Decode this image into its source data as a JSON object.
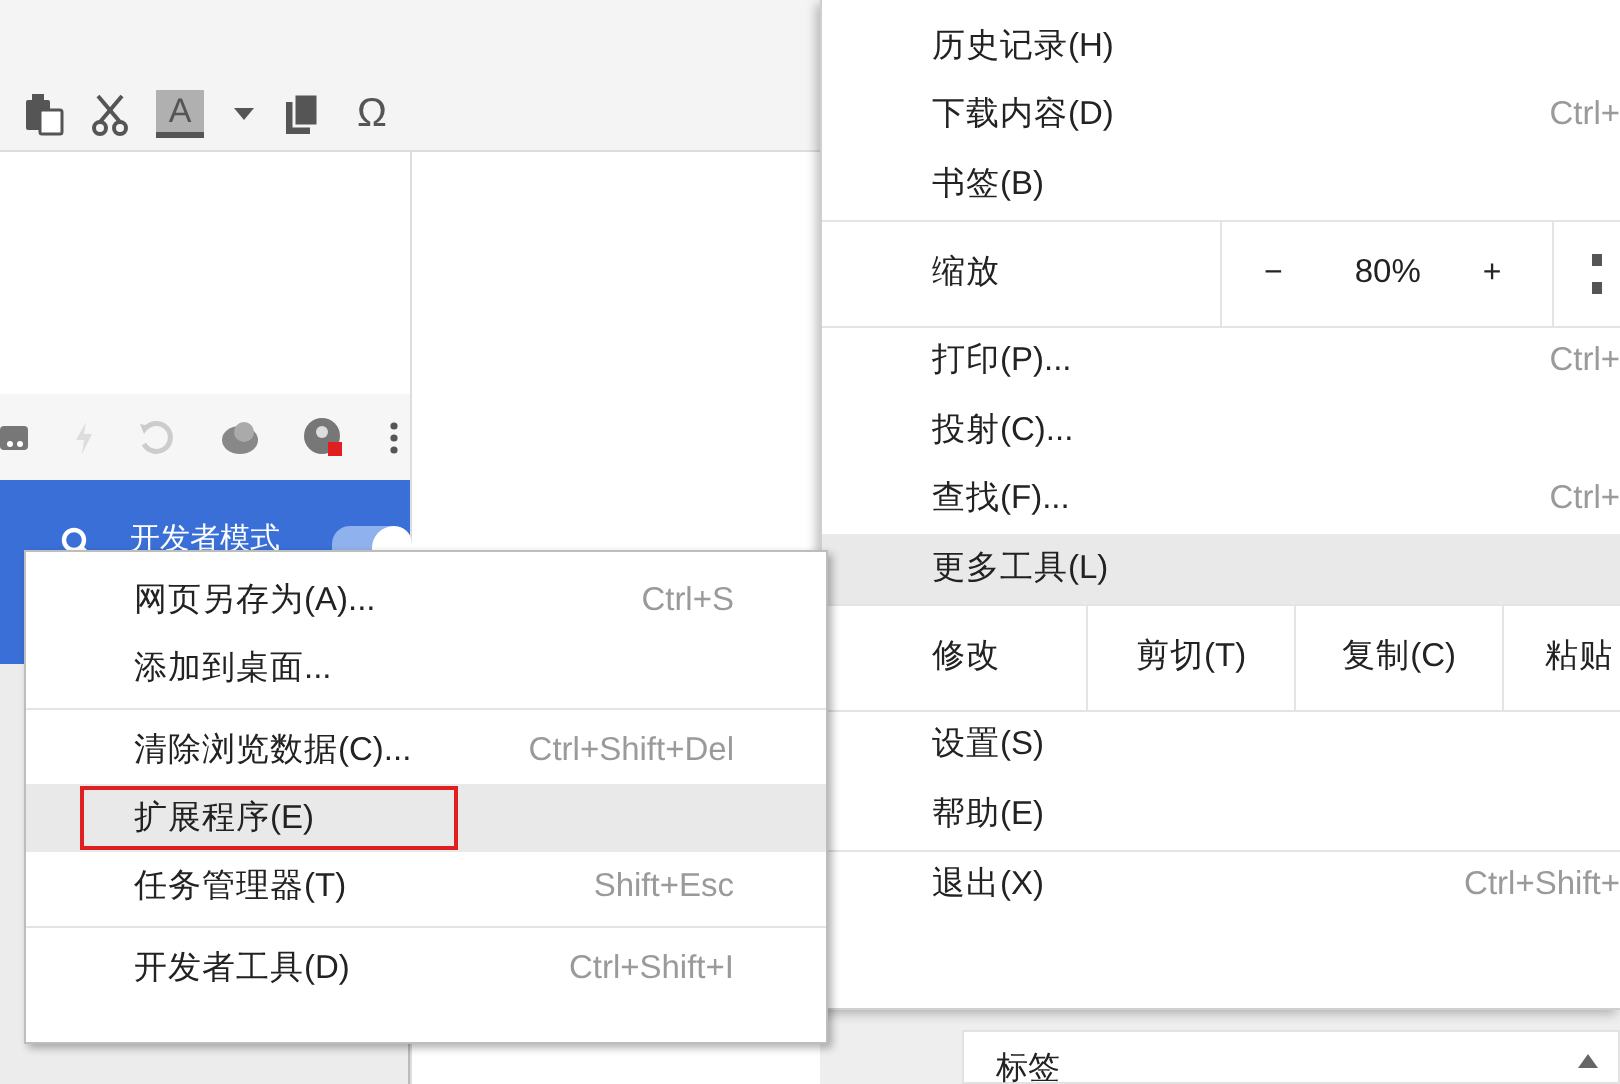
{
  "editor_toolbar": [
    {
      "kind": "paste"
    },
    {
      "kind": "cut"
    },
    {
      "kind": "font_color",
      "label": "A"
    },
    {
      "kind": "copy"
    },
    {
      "kind": "symbol",
      "label": "Ω"
    }
  ],
  "extensions_header": {
    "label": "开发者模式",
    "on": true
  },
  "main_menu": [
    {
      "items": [
        {
          "kind": "item",
          "label": "历史记录(H)",
          "selected": false
        },
        {
          "kind": "item",
          "label": "下载内容(D)",
          "shortcut": "Ctrl+",
          "selected": false
        },
        {
          "kind": "item",
          "label": "书签(B)",
          "selected": false
        }
      ]
    },
    {
      "items": [
        {
          "kind": "zoom",
          "label": "缩放",
          "minus": "−",
          "value": "80%",
          "plus": "+"
        }
      ]
    },
    {
      "items": [
        {
          "kind": "item",
          "label": "打印(P)...",
          "shortcut": "Ctrl+",
          "selected": false
        },
        {
          "kind": "item",
          "label": "投射(C)...",
          "selected": false
        },
        {
          "kind": "item",
          "label": "查找(F)...",
          "shortcut": "Ctrl+",
          "selected": false
        },
        {
          "kind": "item",
          "label": "更多工具(L)",
          "selected": true
        }
      ]
    },
    {
      "items": [
        {
          "kind": "edit",
          "label": "修改",
          "buttons": [
            "剪切(T)",
            "复制(C)",
            "粘贴"
          ]
        }
      ]
    },
    {
      "items": [
        {
          "kind": "item",
          "label": "设置(S)",
          "selected": false
        },
        {
          "kind": "item",
          "label": "帮助(E)",
          "selected": false
        }
      ]
    },
    {
      "items": [
        {
          "kind": "item",
          "label": "退出(X)",
          "shortcut": "Ctrl+Shift+",
          "selected": false
        }
      ]
    }
  ],
  "submenu": [
    {
      "items": [
        {
          "label": "网页另存为(A)...",
          "shortcut": "Ctrl+S",
          "selected": false,
          "outlined": false
        },
        {
          "label": "添加到桌面...",
          "selected": false,
          "outlined": false
        }
      ]
    },
    {
      "items": [
        {
          "label": "清除浏览数据(C)...",
          "shortcut": "Ctrl+Shift+Del",
          "selected": false,
          "outlined": false
        },
        {
          "label": "扩展程序(E)",
          "selected": true,
          "outlined": true
        },
        {
          "label": "任务管理器(T)",
          "shortcut": "Shift+Esc",
          "selected": false,
          "outlined": false
        }
      ]
    },
    {
      "items": [
        {
          "label": "开发者工具(D)",
          "shortcut": "Ctrl+Shift+I",
          "selected": false,
          "outlined": false
        }
      ]
    }
  ],
  "bottom_panel": {
    "label": "标签"
  }
}
